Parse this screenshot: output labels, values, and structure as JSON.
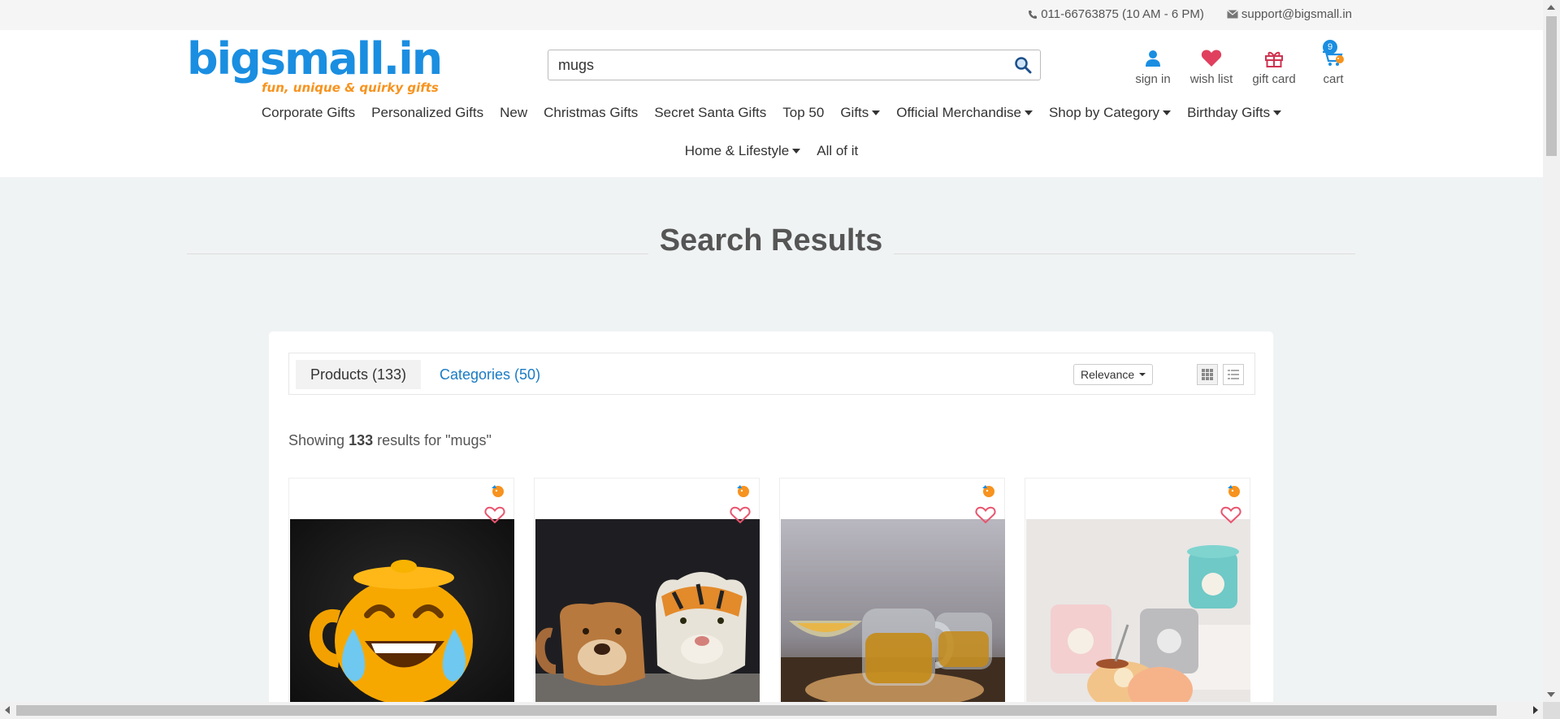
{
  "topbar": {
    "phone": "011-66763875 (10 AM - 6 PM)",
    "email": "support@bigsmall.in"
  },
  "header": {
    "logo_text": "bigsmall.in",
    "logo_tagline": "fun, unique & quirky gifts",
    "search_value": "mugs",
    "icons": {
      "signin": "sign in",
      "wishlist": "wish list",
      "giftcard": "gift card",
      "cart": "cart",
      "cart_count": "9"
    }
  },
  "nav": {
    "row1": [
      "Corporate Gifts",
      "Personalized Gifts",
      "New",
      "Christmas Gifts",
      "Secret Santa Gifts",
      "Top 50",
      "Gifts",
      "Official Merchandise",
      "Shop by Category",
      "Birthday Gifts"
    ],
    "row2": [
      "Home & Lifestyle",
      "All of it"
    ]
  },
  "page_title": "Search Results",
  "results": {
    "tab_products": "Products (133)",
    "tab_categories": "Categories (50)",
    "sort_label": "Relevance",
    "showing_prefix": "Showing",
    "showing_count": "133",
    "showing_suffix": "results for \"mugs\""
  },
  "colors": {
    "brand_blue": "#1a8ee1",
    "brand_orange": "#f7931e",
    "link_blue": "#1a7bc4",
    "heart_pink": "#e8556e"
  }
}
